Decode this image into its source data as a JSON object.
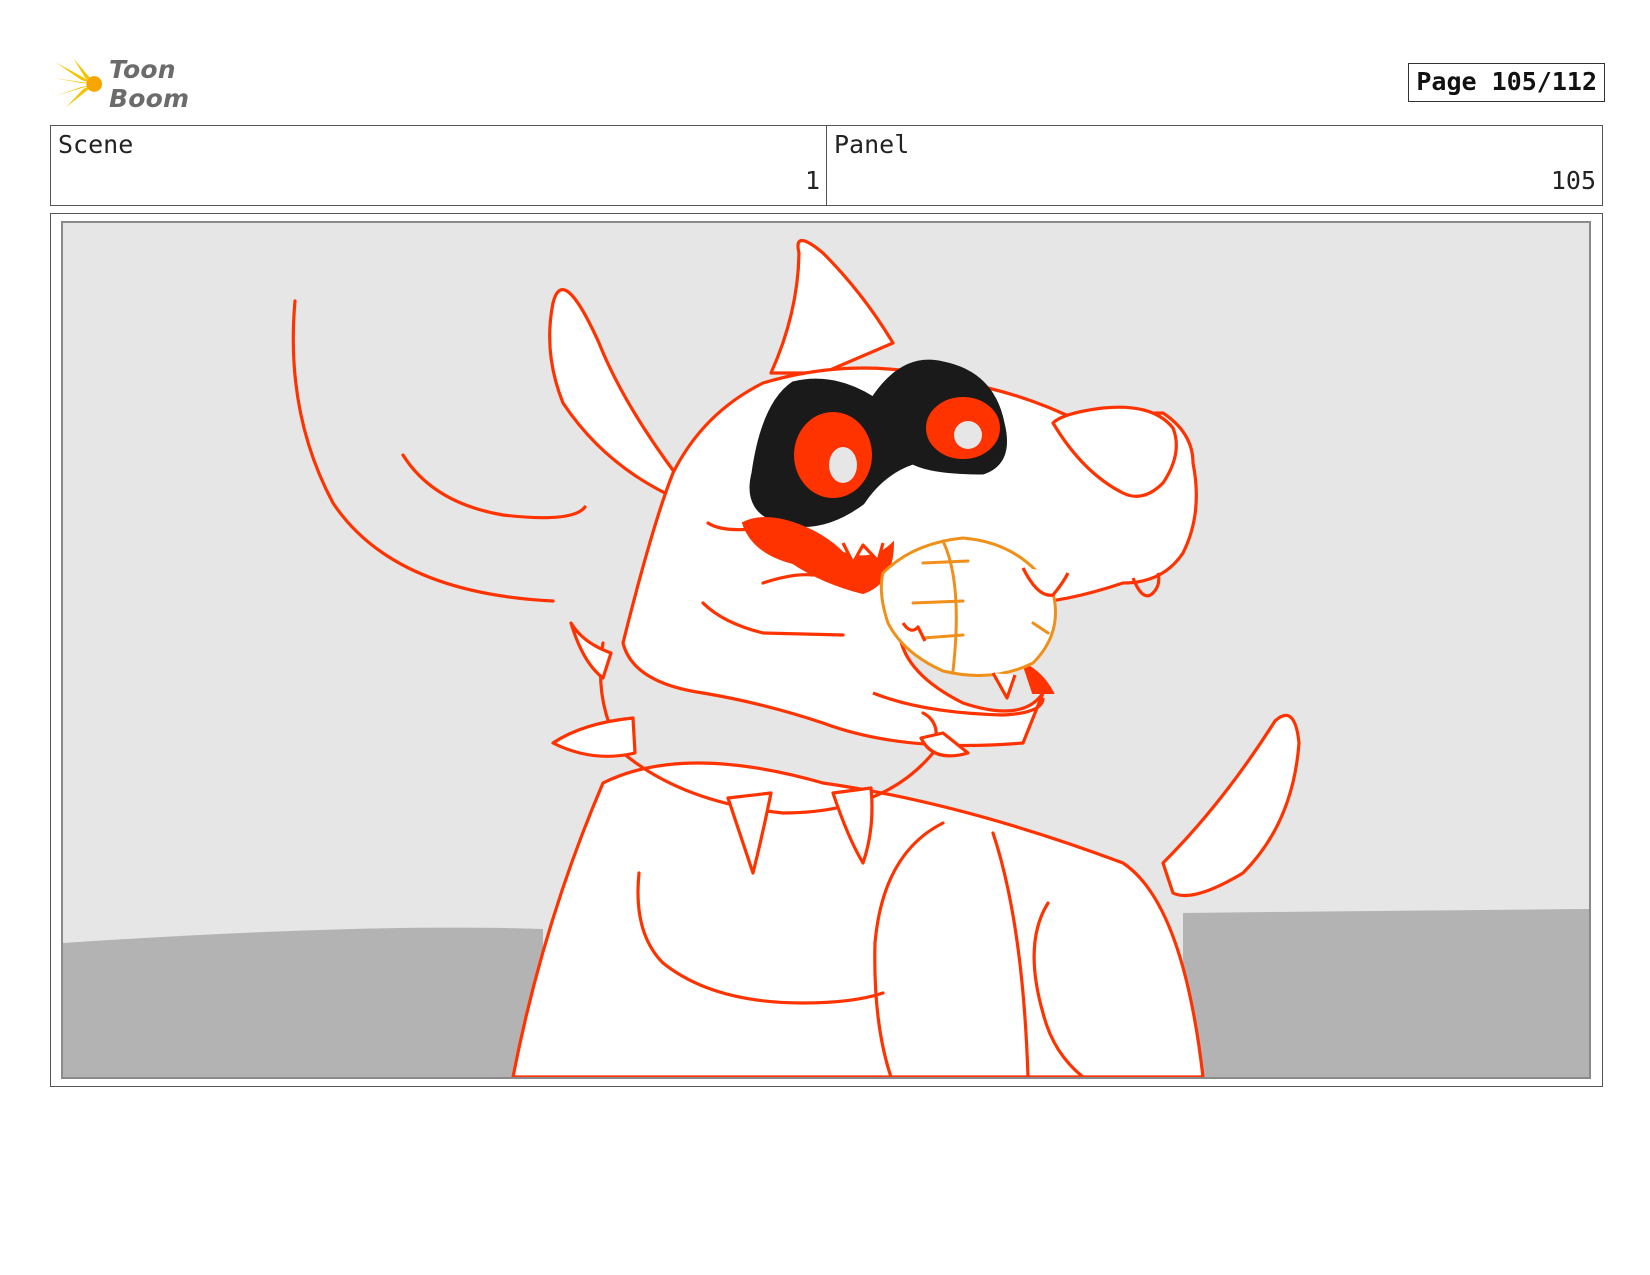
{
  "header": {
    "logo_text": "Toon Boom",
    "logo_icon": "starburst-logo-icon",
    "page_label": "Page 105/112"
  },
  "info": {
    "scene_label": "Scene",
    "scene_value": "1",
    "panel_label": "Panel",
    "panel_value": "105"
  },
  "drawing": {
    "subject": "dog-with-ball-sketch",
    "colors": {
      "line": "#ff3300",
      "ball_line": "#f0901a",
      "mask": "#1a1a1a",
      "sky": "#e6e6e6",
      "ground": "#b3b3b3",
      "fill": "#ffffff"
    }
  }
}
